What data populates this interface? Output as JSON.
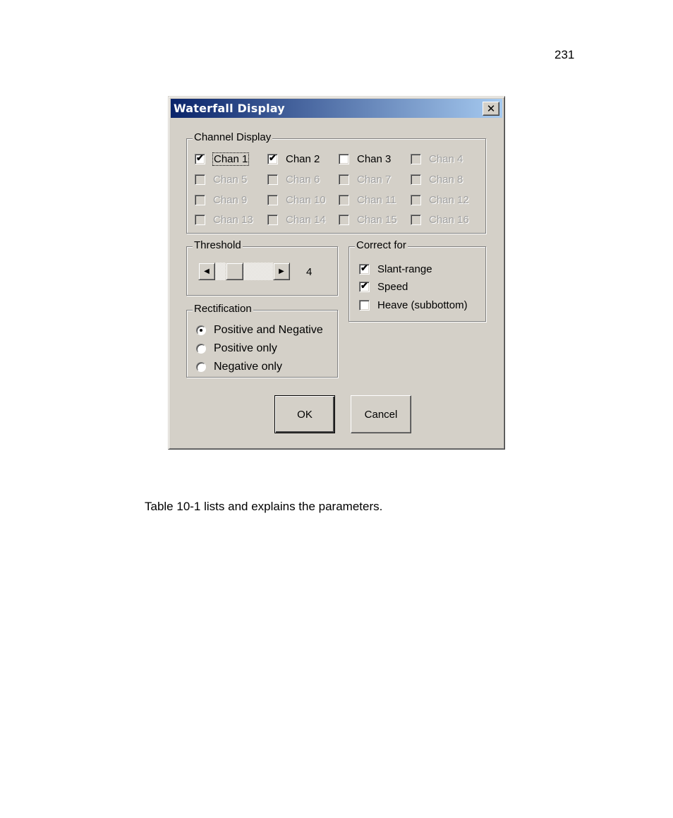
{
  "page": {
    "page_number": "231",
    "caption": "Table 10-1 lists and explains the parameters."
  },
  "dialog": {
    "title": "Waterfall Display",
    "close_glyph": "✕",
    "channel_display": {
      "label": "Channel Display",
      "channels": [
        {
          "label": "Chan 1",
          "checked": true,
          "enabled": true,
          "focused": true
        },
        {
          "label": "Chan 2",
          "checked": true,
          "enabled": true,
          "focused": false
        },
        {
          "label": "Chan 3",
          "checked": false,
          "enabled": true,
          "focused": false
        },
        {
          "label": "Chan 4",
          "checked": false,
          "enabled": false,
          "focused": false
        },
        {
          "label": "Chan 5",
          "checked": false,
          "enabled": false,
          "focused": false
        },
        {
          "label": "Chan 6",
          "checked": false,
          "enabled": false,
          "focused": false
        },
        {
          "label": "Chan 7",
          "checked": false,
          "enabled": false,
          "focused": false
        },
        {
          "label": "Chan 8",
          "checked": false,
          "enabled": false,
          "focused": false
        },
        {
          "label": "Chan 9",
          "checked": false,
          "enabled": false,
          "focused": false
        },
        {
          "label": "Chan 10",
          "checked": false,
          "enabled": false,
          "focused": false
        },
        {
          "label": "Chan 11",
          "checked": false,
          "enabled": false,
          "focused": false
        },
        {
          "label": "Chan 12",
          "checked": false,
          "enabled": false,
          "focused": false
        },
        {
          "label": "Chan 13",
          "checked": false,
          "enabled": false,
          "focused": false
        },
        {
          "label": "Chan 14",
          "checked": false,
          "enabled": false,
          "focused": false
        },
        {
          "label": "Chan 15",
          "checked": false,
          "enabled": false,
          "focused": false
        },
        {
          "label": "Chan 16",
          "checked": false,
          "enabled": false,
          "focused": false
        }
      ]
    },
    "threshold": {
      "label": "Threshold",
      "value": "4",
      "thumb_fraction": 0.26,
      "left_arrow": "◀",
      "right_arrow": "▶"
    },
    "correct_for": {
      "label": "Correct for",
      "options": [
        {
          "label": "Slant-range",
          "checked": true
        },
        {
          "label": "Speed",
          "checked": true
        },
        {
          "label": "Heave (subbottom)",
          "checked": false
        }
      ]
    },
    "rectification": {
      "label": "Rectification",
      "options": [
        {
          "label": "Positive and Negative",
          "selected": true
        },
        {
          "label": "Positive only",
          "selected": false
        },
        {
          "label": "Negative only",
          "selected": false
        }
      ]
    },
    "buttons": {
      "ok": "OK",
      "cancel": "Cancel"
    },
    "check_glyph": "✔"
  }
}
